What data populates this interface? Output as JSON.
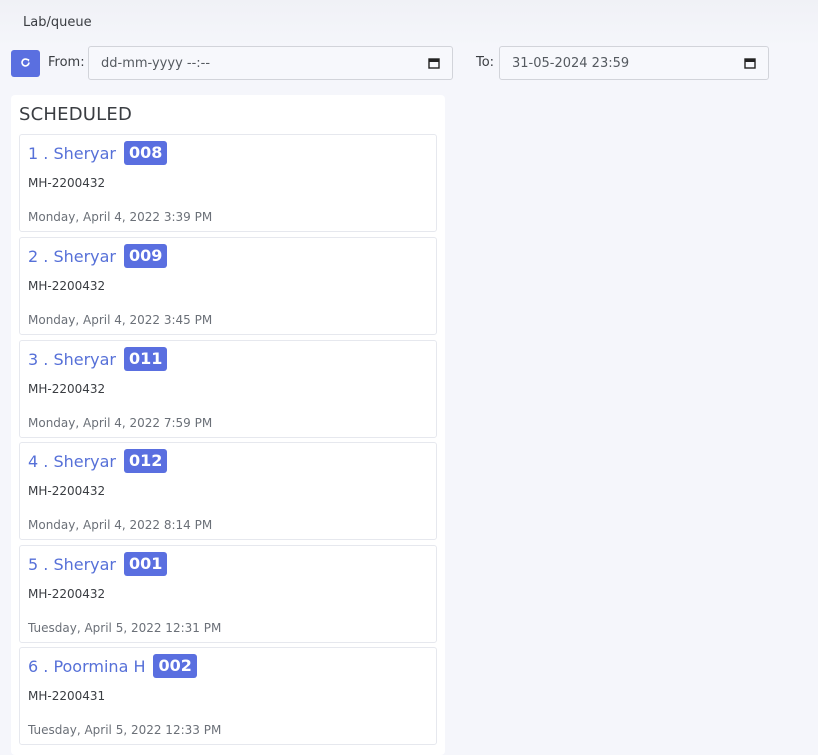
{
  "breadcrumb": "Lab/queue",
  "filters": {
    "refresh_icon": "refresh-icon",
    "from_label": "From:",
    "from_value": "dd-mm-yyyy --:--",
    "to_label": "To:",
    "to_value": "31-05-2024 23:59"
  },
  "panel": {
    "title": "SCHEDULED"
  },
  "queue": [
    {
      "name": "1 . Sheryar",
      "badge": "008",
      "id": "MH-2200432",
      "date": "Monday, April 4, 2022 3:39 PM"
    },
    {
      "name": "2 . Sheryar",
      "badge": "009",
      "id": "MH-2200432",
      "date": "Monday, April 4, 2022 3:45 PM"
    },
    {
      "name": "3 . Sheryar",
      "badge": "011",
      "id": "MH-2200432",
      "date": "Monday, April 4, 2022 7:59 PM"
    },
    {
      "name": "4 . Sheryar",
      "badge": "012",
      "id": "MH-2200432",
      "date": "Monday, April 4, 2022 8:14 PM"
    },
    {
      "name": "5 . Sheryar",
      "badge": "001",
      "id": "MH-2200432",
      "date": "Tuesday, April 5, 2022 12:31 PM"
    },
    {
      "name": "6 . Poormina H",
      "badge": "002",
      "id": "MH-2200431",
      "date": "Tuesday, April 5, 2022 12:33 PM"
    }
  ],
  "colors": {
    "accent": "#5a6fe0",
    "name_text": "#5670d8",
    "background": "#f5f6fb"
  }
}
